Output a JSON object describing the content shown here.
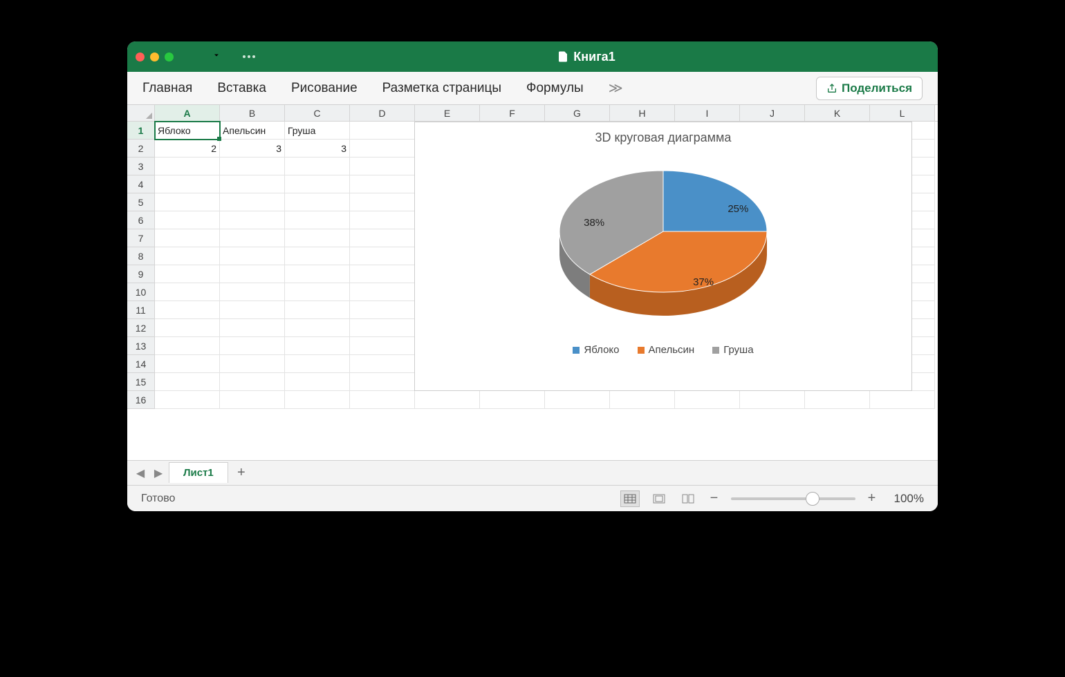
{
  "window": {
    "title": "Книга1"
  },
  "ribbon": {
    "tabs": [
      "Главная",
      "Вставка",
      "Рисование",
      "Разметка страницы",
      "Формулы"
    ],
    "more": "≫",
    "share": "Поделиться"
  },
  "columns": [
    "A",
    "B",
    "C",
    "D",
    "E",
    "F",
    "G",
    "H",
    "I",
    "J",
    "K",
    "L"
  ],
  "active_col": "A",
  "active_row": 1,
  "cells": {
    "A1": "Яблоко",
    "B1": "Апельсин",
    "C1": "Груша",
    "A2": "2",
    "B2": "3",
    "C2": "3"
  },
  "sheet": {
    "name": "Лист1"
  },
  "status": {
    "ready": "Готово",
    "zoom": "100%"
  },
  "chart_data": {
    "type": "pie",
    "title": "3D круговая диаграмма",
    "categories": [
      "Яблоко",
      "Апельсин",
      "Груша"
    ],
    "values": [
      2,
      3,
      3
    ],
    "percent_labels": [
      "25%",
      "37%",
      "38%"
    ],
    "colors": [
      "#4a90c8",
      "#e87a2d",
      "#a0a0a0"
    ],
    "side_colors": [
      "#3a72a0",
      "#b85f1f",
      "#7d7d7d"
    ]
  }
}
